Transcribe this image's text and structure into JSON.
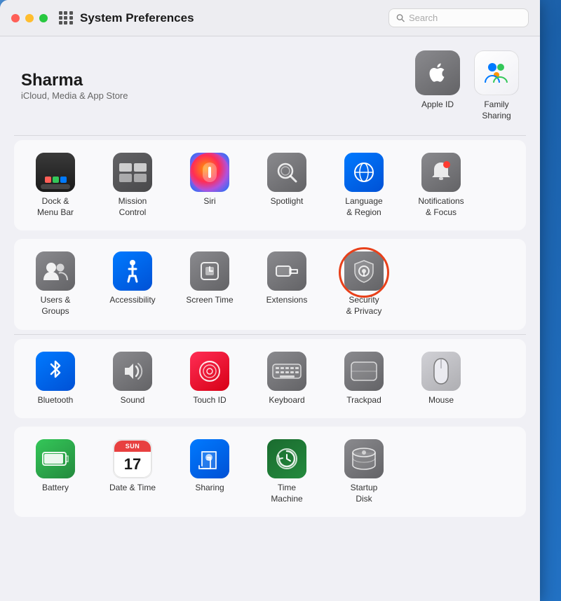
{
  "window": {
    "title": "System Preferences",
    "search_placeholder": "Search"
  },
  "profile": {
    "name": "Sharma",
    "subtitle": "iCloud, Media & App Store"
  },
  "profile_icons": [
    {
      "id": "apple-id",
      "label": "Apple ID",
      "emoji": "🍎"
    },
    {
      "id": "family-sharing",
      "label": "Family\nSharing",
      "emoji": "👨‍👩‍👧"
    }
  ],
  "rows": [
    {
      "id": "row1",
      "items": [
        {
          "id": "dock",
          "label": "Dock &\nMenu Bar",
          "emoji": "🖥"
        },
        {
          "id": "mission-control",
          "label": "Mission\nControl",
          "emoji": "⊞"
        },
        {
          "id": "siri",
          "label": "Siri",
          "emoji": "🔮"
        },
        {
          "id": "spotlight",
          "label": "Spotlight",
          "emoji": "🔍"
        },
        {
          "id": "language-region",
          "label": "Language\n& Region",
          "emoji": "🌐"
        },
        {
          "id": "notifications",
          "label": "Notifications\n& Focus",
          "emoji": "🔔"
        }
      ]
    },
    {
      "id": "row2",
      "items": [
        {
          "id": "users-groups",
          "label": "Users &\nGroups",
          "emoji": "👥"
        },
        {
          "id": "accessibility",
          "label": "Accessibility",
          "emoji": "♿"
        },
        {
          "id": "screen-time",
          "label": "Screen Time",
          "emoji": "⏳"
        },
        {
          "id": "extensions",
          "label": "Extensions",
          "emoji": "🧩"
        },
        {
          "id": "security-privacy",
          "label": "Security\n& Privacy",
          "emoji": "🏠",
          "selected": true
        }
      ]
    },
    {
      "id": "row3",
      "items": [
        {
          "id": "bluetooth",
          "label": "Bluetooth",
          "emoji": "🔵"
        },
        {
          "id": "sound",
          "label": "Sound",
          "emoji": "🔊"
        },
        {
          "id": "touch-id",
          "label": "Touch ID",
          "emoji": "👆"
        },
        {
          "id": "keyboard",
          "label": "Keyboard",
          "emoji": "⌨"
        },
        {
          "id": "trackpad",
          "label": "Trackpad",
          "emoji": "▭"
        },
        {
          "id": "mouse",
          "label": "Mouse",
          "emoji": "🖱"
        }
      ]
    },
    {
      "id": "row4",
      "items": [
        {
          "id": "battery",
          "label": "Battery",
          "emoji": "🔋"
        },
        {
          "id": "date-time",
          "label": "Date & Time",
          "emoji": "🕐"
        },
        {
          "id": "sharing",
          "label": "Sharing",
          "emoji": "📁"
        },
        {
          "id": "time-machine",
          "label": "Time\nMachine",
          "emoji": "🔄"
        },
        {
          "id": "startup-disk",
          "label": "Startup\nDisk",
          "emoji": "💽"
        }
      ]
    }
  ]
}
